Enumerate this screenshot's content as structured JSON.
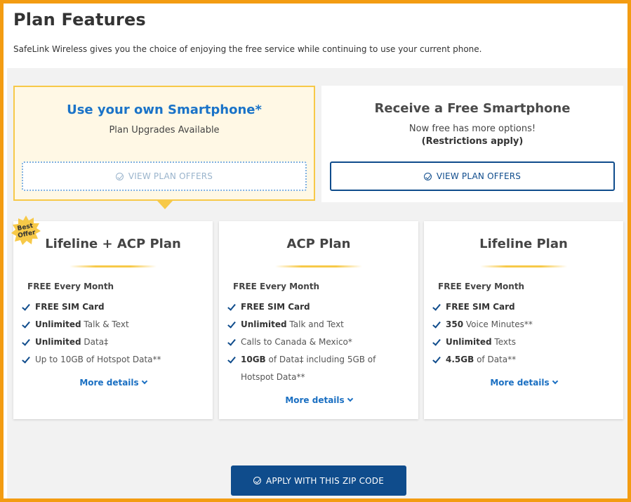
{
  "header": {
    "title": "Plan Features",
    "subtitle": "SafeLink Wireless gives you the choice of enjoying the free service while continuing to use your current phone."
  },
  "options": {
    "own": {
      "title": "Use your own Smartphone*",
      "subtitle": "Plan Upgrades Available",
      "button_label": "VIEW PLAN OFFERS"
    },
    "free": {
      "title": "Receive a Free Smartphone",
      "subtitle": "Now free has more options!",
      "note": "(Restrictions apply)",
      "button_label": "VIEW PLAN OFFERS"
    }
  },
  "badge": {
    "line1": "Best",
    "line2": "Offer"
  },
  "plans": [
    {
      "title": "Lifeline + ACP Plan",
      "free_label": "FREE Every Month",
      "features": [
        {
          "bold": "FREE SIM Card",
          "rest": ""
        },
        {
          "bold": "Unlimited",
          "rest": " Talk & Text"
        },
        {
          "bold": "Unlimited",
          "rest": " Data‡"
        },
        {
          "bold": "",
          "rest": "Up to 10GB of Hotspot Data**"
        }
      ],
      "more_label": "More details"
    },
    {
      "title": "ACP Plan",
      "free_label": "FREE Every Month",
      "features": [
        {
          "bold": "FREE SIM Card",
          "rest": ""
        },
        {
          "bold": "Unlimited",
          "rest": " Talk and Text"
        },
        {
          "bold": "",
          "rest": "Calls to Canada & Mexico*"
        },
        {
          "bold": "10GB",
          "rest": " of Data‡ including 5GB of Hotspot Data**"
        }
      ],
      "more_label": "More details"
    },
    {
      "title": "Lifeline Plan",
      "free_label": "FREE Every Month",
      "features": [
        {
          "bold": "FREE SIM Card",
          "rest": ""
        },
        {
          "bold": "350",
          "rest": " Voice Minutes**"
        },
        {
          "bold": "Unlimited",
          "rest": " Texts"
        },
        {
          "bold": "4.5GB",
          "rest": " of Data**"
        }
      ],
      "more_label": "More details"
    }
  ],
  "apply": {
    "label": "APPLY WITH THIS ZIP CODE"
  },
  "colors": {
    "accent_border": "#f39c12",
    "gold": "#f7c948",
    "primary_blue": "#0f4c8c",
    "link_blue": "#1a6fc2"
  }
}
